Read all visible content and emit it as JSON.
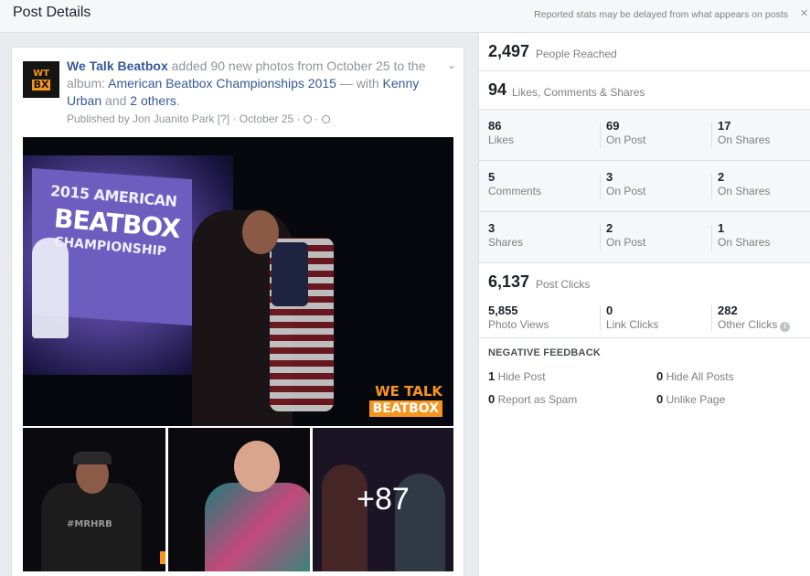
{
  "header": {
    "title": "Post Details",
    "note": "Reported stats may be delayed from what appears on posts",
    "close_glyph": "×"
  },
  "post": {
    "page_name": "We Talk Beatbox",
    "avatar_top": "WT",
    "avatar_bottom": "BX",
    "action": " added 90 new photos from October 25 to the album: ",
    "album": "American Beatbox Championships 2015",
    "with": " — with ",
    "tag1": "Kenny Urban",
    "and": " and ",
    "tag2": "2 others",
    "period": ".",
    "published_by": "Published by Jon Juanito Park",
    "help": "[?]",
    "date": "· October 25 ·",
    "dot": "·",
    "menu_glyph": "⌄",
    "main_photo": {
      "banner_line1": "2015 AMERICAN",
      "banner_line2": "BEATBOX",
      "banner_line3": "CHAMPIONSHIP",
      "logo_line1": "WE TALK",
      "logo_line2": "BEATBOX"
    },
    "thumb1_shirt": "#MRHRB",
    "more_count": "+87"
  },
  "stats": {
    "reach": {
      "value": "2,497",
      "label": "People Reached"
    },
    "engagement": {
      "value": "94",
      "label": "Likes, Comments & Shares"
    },
    "likes": [
      {
        "n": "86",
        "l": "Likes"
      },
      {
        "n": "69",
        "l": "On Post"
      },
      {
        "n": "17",
        "l": "On Shares"
      }
    ],
    "comments": [
      {
        "n": "5",
        "l": "Comments"
      },
      {
        "n": "3",
        "l": "On Post"
      },
      {
        "n": "2",
        "l": "On Shares"
      }
    ],
    "shares": [
      {
        "n": "3",
        "l": "Shares"
      },
      {
        "n": "2",
        "l": "On Post"
      },
      {
        "n": "1",
        "l": "On Shares"
      }
    ],
    "clicks": {
      "value": "6,137",
      "label": "Post Clicks",
      "items": [
        {
          "n": "5,855",
          "l": "Photo Views"
        },
        {
          "n": "0",
          "l": "Link Clicks"
        },
        {
          "n": "282",
          "l": "Other Clicks"
        }
      ],
      "info_glyph": "i"
    },
    "negative": {
      "heading": "NEGATIVE FEEDBACK",
      "hide_post": {
        "n": "1",
        "l": "Hide Post"
      },
      "hide_all": {
        "n": "0",
        "l": "Hide All Posts"
      },
      "spam": {
        "n": "0",
        "l": "Report as Spam"
      },
      "unlike": {
        "n": "0",
        "l": "Unlike Page"
      }
    }
  }
}
